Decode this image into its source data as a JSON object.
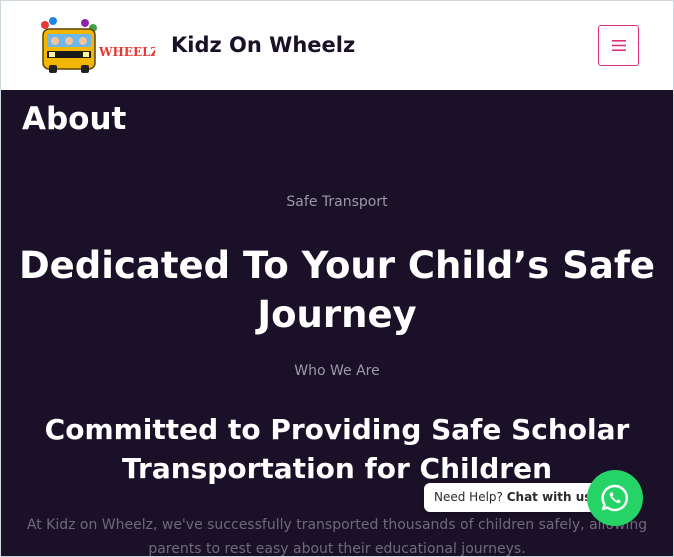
{
  "header": {
    "logo_text": "WHEELZ",
    "brand": "Kidz On Wheelz",
    "menu_icon": "hamburger-icon"
  },
  "page": {
    "title": "About"
  },
  "hero": {
    "eyebrow": "Safe Transport",
    "heading_line1": "Dedicated To Your Child’s Safe",
    "heading_line2": "Journey"
  },
  "about_section": {
    "eyebrow": "Who We Are",
    "heading_line1": "Committed to Providing Safe Scholar",
    "heading_line2": "Transportation for Children",
    "paragraph": "At Kidz on Wheelz, we've successfully transported thousands of children safely, allowing parents to rest easy about their educational journeys."
  },
  "chat": {
    "prefix": "Need Help?",
    "cta": "Chat with us",
    "icon": "whatsapp-icon"
  },
  "colors": {
    "background": "#1a1128",
    "accent": "#e0307a",
    "whatsapp": "#25d366"
  }
}
